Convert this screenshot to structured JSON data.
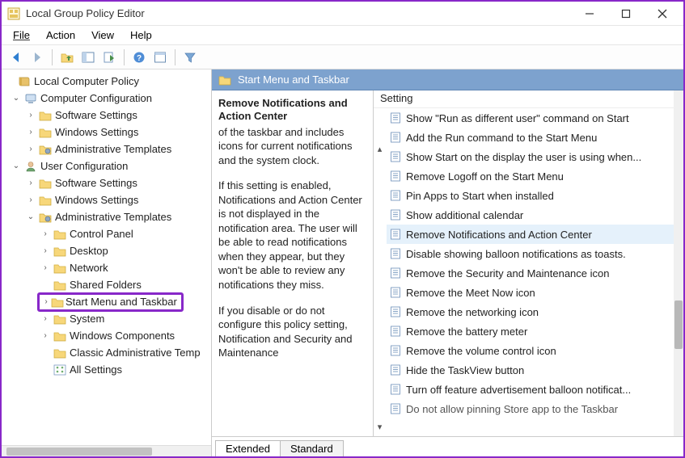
{
  "window": {
    "title": "Local Group Policy Editor"
  },
  "menu": {
    "file": "File",
    "action": "Action",
    "view": "View",
    "help": "Help"
  },
  "tree": {
    "root": "Local Computer Policy",
    "cc": "Computer Configuration",
    "cc_sw": "Software Settings",
    "cc_win": "Windows Settings",
    "cc_admin": "Administrative Templates",
    "uc": "User Configuration",
    "uc_sw": "Software Settings",
    "uc_win": "Windows Settings",
    "uc_admin": "Administrative Templates",
    "cp": "Control Panel",
    "desktop": "Desktop",
    "network": "Network",
    "shared": "Shared Folders",
    "start": "Start Menu and Taskbar",
    "system": "System",
    "wincomp": "Windows Components",
    "classic": "Classic Administrative Temp",
    "allset": "All Settings"
  },
  "rp": {
    "header": "Start Menu and Taskbar",
    "desc_title": "Remove Notifications and Action Center",
    "desc_p1": "of the taskbar and includes icons for current notifications and the system clock.",
    "desc_p2": "If this setting is enabled, Notifications and Action Center is not displayed in the notification area. The user will be able to read notifications when they appear, but they won't be able to review any notifications they miss.",
    "desc_p3": "If you disable or do not configure this policy setting, Notification and Security and Maintenance",
    "list_header": "Setting",
    "items": [
      "Show \"Run as different user\" command on Start",
      "Add the Run command to the Start Menu",
      "Show Start on the display the user is using when...",
      "Remove Logoff on the Start Menu",
      "Pin Apps to Start when installed",
      "Show additional calendar",
      "Remove Notifications and Action Center",
      "Disable showing balloon notifications as toasts.",
      "Remove the Security and Maintenance icon",
      "Remove the Meet Now icon",
      "Remove the networking icon",
      "Remove the battery meter",
      "Remove the volume control icon",
      "Hide the TaskView button",
      "Turn off feature advertisement balloon notificat...",
      "Do not allow pinning Store app to the Taskbar"
    ],
    "selected_index": 6
  },
  "tabs": {
    "extended": "Extended",
    "standard": "Standard"
  }
}
